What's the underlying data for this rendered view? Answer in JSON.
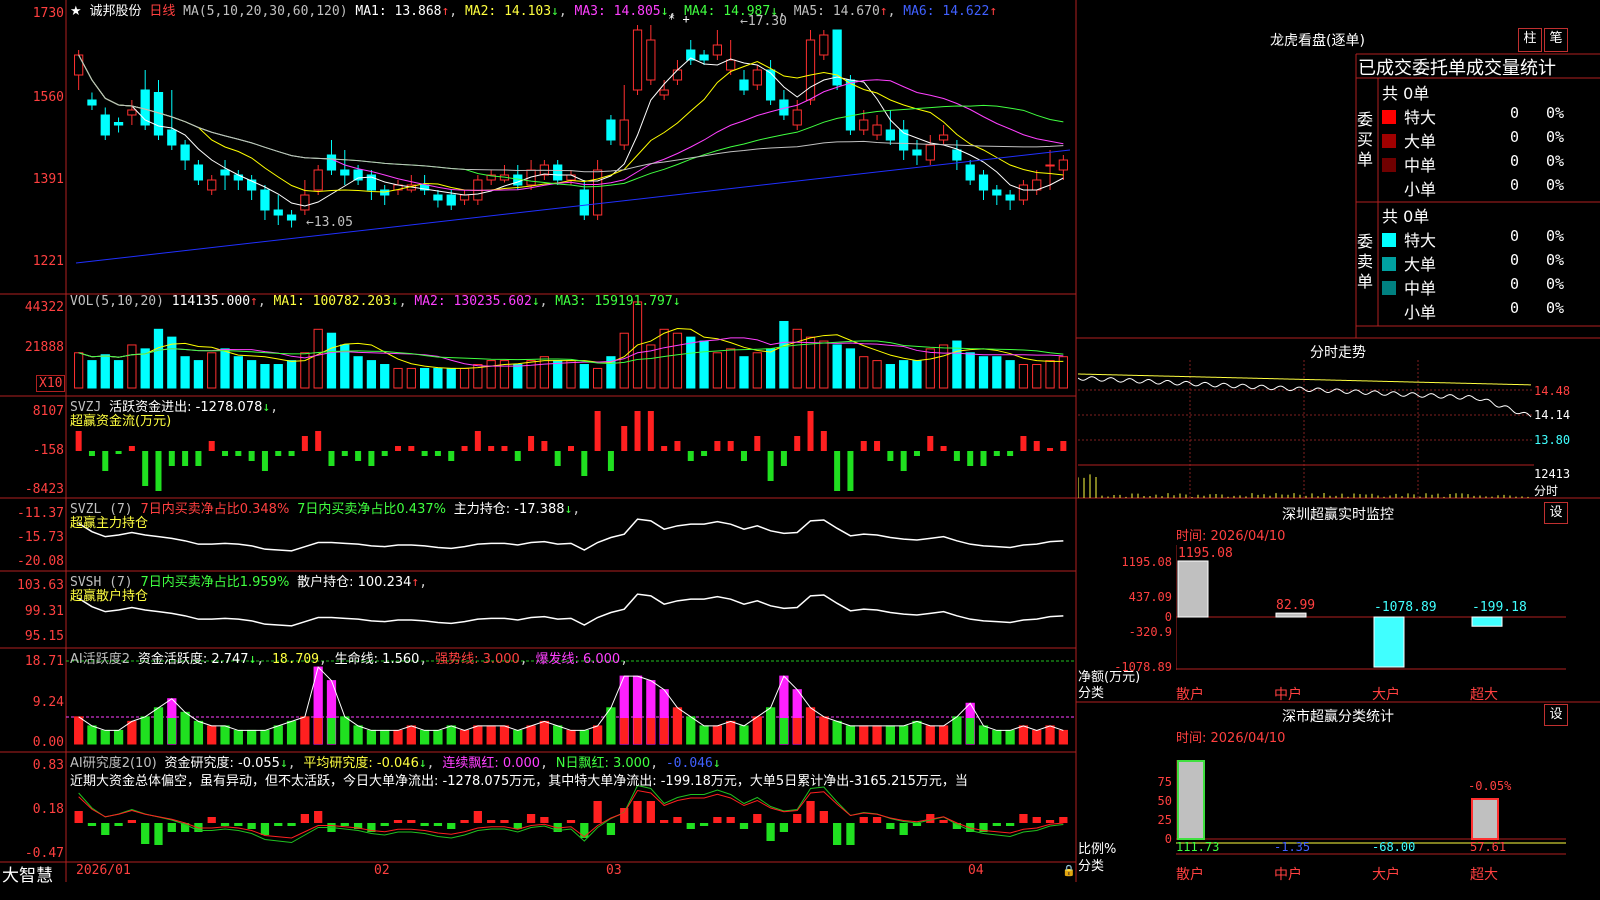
{
  "stock": {
    "name": "诚邦股份",
    "period": "日线",
    "ma_label": "MA(5,10,20,30,60,120)",
    "ma1": "MA1: 13.868",
    "ma2": "MA2: 14.103",
    "ma3": "MA3: 14.805",
    "ma4": "MA4: 14.987",
    "ma5": "MA5: 14.670",
    "ma6": "MA6: 14.622",
    "high_mark": "17.30",
    "low_mark": "13.05"
  },
  "price_axis": [
    "1730",
    "1560",
    "1391",
    "1221"
  ],
  "vol": {
    "label": "VOL(5,10,20)",
    "value": "114135.000",
    "ma1": "MA1: 100782.203",
    "ma2": "MA2: 130235.602",
    "ma3": "MA3: 159191.797",
    "axis": [
      "44322",
      "21888"
    ],
    "unit": "X10"
  },
  "svzj": {
    "label": "SVZJ",
    "desc": "活跃资金进出: -1278.078",
    "sub": "超赢资金流(万元)",
    "axis": [
      "8107",
      "-158",
      "-8423"
    ]
  },
  "svzl": {
    "label": "SVZL (7)",
    "pct1": "7日内买卖净占比0.348%",
    "pct2": "7日内买卖净占比0.437%",
    "main": "主力持仓: -17.388",
    "sub": "超赢主力持仓",
    "axis": [
      "-11.37",
      "-15.73",
      "-20.08"
    ]
  },
  "svsh": {
    "label": "SVSH (7)",
    "pct": "7日内买卖净占比1.959%",
    "retail": "散户持仓: 100.234",
    "sub": "超赢散户持仓",
    "axis": [
      "103.63",
      "99.31",
      "95.15"
    ]
  },
  "ai2": {
    "label": "AI活跃度2",
    "active": "资金活跃度: 2.747",
    "v2": "18.709",
    "life": "生命线: 1.560",
    "strong": "强势线: 3.000",
    "burst": "爆发线: 6.000",
    "axis": [
      "18.71",
      "9.24",
      "0.00"
    ]
  },
  "ai_research": {
    "label": "AI研究度2(10)",
    "r1": "资金研究度: -0.055",
    "r2": "平均研究度: -0.046",
    "r3": "连续飘红: 0.000",
    "r4": "N日飘红: 3.000",
    "r5": "-0.046",
    "summary": "近期大资金总体偏空，虽有异动，但不太活跃，今日大单净流出: -1278.075万元，其中特大单净流出: -199.18万元，大单5日累计净出-3165.215万元，当",
    "axis": [
      "0.83",
      "0.18",
      "-0.47"
    ]
  },
  "date_axis": [
    "2026/01",
    "02",
    "03",
    "04"
  ],
  "brand": "大智慧",
  "right": {
    "lhb_title": "龙虎看盘(逐单)",
    "btn_zhu": "柱",
    "btn_bi": "笔",
    "stat_title": "已成交委托单成交量统计",
    "buy": {
      "side": "委买单",
      "total": "共 0单",
      "rows": [
        {
          "name": "特大",
          "n": "0",
          "p": "0%",
          "c": "#ff0000"
        },
        {
          "name": "大单",
          "n": "0",
          "p": "0%",
          "c": "#a00000"
        },
        {
          "name": "中单",
          "n": "0",
          "p": "0%",
          "c": "#700000"
        },
        {
          "name": "小单",
          "n": "0",
          "p": "0%",
          "c": ""
        }
      ]
    },
    "sell": {
      "side": "委卖单",
      "total": "共 0单",
      "rows": [
        {
          "name": "特大",
          "n": "0",
          "p": "0%",
          "c": "#00ffff"
        },
        {
          "name": "大单",
          "n": "0",
          "p": "0%",
          "c": "#00a0a0"
        },
        {
          "name": "中单",
          "n": "0",
          "p": "0%",
          "c": "#008080"
        },
        {
          "name": "小单",
          "n": "0",
          "p": "0%",
          "c": ""
        }
      ]
    },
    "intraday_title": "分时走势",
    "intraday_axis": [
      "14.48",
      "14.14",
      "13.80",
      "12413",
      "分时"
    ],
    "sz_title": "深圳超赢实时监控",
    "sz_btn": "设",
    "sz_time": "时间: 2026/04/10",
    "sz_axis": [
      "1195.08",
      "437.09",
      "0",
      "-320.9",
      "-1078.89"
    ],
    "sz_values": [
      "1195.08",
      "82.99",
      "-1078.89",
      "-199.18"
    ],
    "sz_ylabel": "净额(万元)",
    "sz_xlabel": "分类",
    "cats": [
      "散户",
      "中户",
      "大户",
      "超大"
    ],
    "cl_title": "深市超赢分类统计",
    "cl_btn": "设",
    "cl_time": "时间: 2026/04/10",
    "cl_axis": [
      "75",
      "50",
      "25",
      "0"
    ],
    "cl_top": "-0.05%",
    "cl_values": [
      "111.73",
      "-1.35",
      "-68.00",
      "57.61"
    ],
    "cl_ylabel": "比例%",
    "cl_xlabel": "分类"
  },
  "chart_data": {
    "type": "candlestick",
    "candles": [
      [
        1610,
        1650,
        1660,
        1580
      ],
      [
        1560,
        1550,
        1575,
        1540
      ],
      [
        1530,
        1490,
        1545,
        1480
      ],
      [
        1515,
        1510,
        1525,
        1495
      ],
      [
        1530,
        1540,
        1560,
        1510
      ],
      [
        1580,
        1510,
        1620,
        1500
      ],
      [
        1575,
        1490,
        1600,
        1480
      ],
      [
        1500,
        1470,
        1580,
        1460
      ],
      [
        1470,
        1440,
        1480,
        1420
      ],
      [
        1430,
        1400,
        1440,
        1390
      ],
      [
        1380,
        1400,
        1410,
        1370
      ],
      [
        1420,
        1410,
        1440,
        1380
      ],
      [
        1410,
        1400,
        1420,
        1380
      ],
      [
        1400,
        1380,
        1410,
        1360
      ],
      [
        1380,
        1340,
        1390,
        1320
      ],
      [
        1340,
        1330,
        1370,
        1310
      ],
      [
        1330,
        1320,
        1340,
        1305
      ],
      [
        1340,
        1370,
        1400,
        1330
      ],
      [
        1380,
        1420,
        1430,
        1370
      ],
      [
        1450,
        1420,
        1480,
        1410
      ],
      [
        1420,
        1410,
        1460,
        1390
      ],
      [
        1420,
        1400,
        1430,
        1390
      ],
      [
        1410,
        1380,
        1420,
        1360
      ],
      [
        1380,
        1370,
        1390,
        1350
      ],
      [
        1380,
        1390,
        1400,
        1370
      ],
      [
        1380,
        1390,
        1410,
        1375
      ],
      [
        1390,
        1380,
        1410,
        1370
      ],
      [
        1370,
        1360,
        1380,
        1345
      ],
      [
        1370,
        1350,
        1380,
        1340
      ],
      [
        1360,
        1370,
        1380,
        1350
      ],
      [
        1360,
        1400,
        1410,
        1350
      ],
      [
        1400,
        1410,
        1420,
        1390
      ],
      [
        1400,
        1410,
        1430,
        1395
      ],
      [
        1410,
        1390,
        1430,
        1380
      ],
      [
        1390,
        1420,
        1440,
        1380
      ],
      [
        1410,
        1430,
        1440,
        1400
      ],
      [
        1430,
        1400,
        1440,
        1390
      ],
      [
        1400,
        1410,
        1420,
        1390
      ],
      [
        1380,
        1330,
        1400,
        1320
      ],
      [
        1330,
        1420,
        1440,
        1320
      ],
      [
        1520,
        1480,
        1530,
        1470
      ],
      [
        1470,
        1520,
        1590,
        1460
      ],
      [
        1580,
        1700,
        1710,
        1570
      ],
      [
        1600,
        1680,
        1710,
        1590
      ],
      [
        1570,
        1580,
        1600,
        1560
      ],
      [
        1600,
        1620,
        1640,
        1590
      ],
      [
        1660,
        1640,
        1680,
        1630
      ],
      [
        1650,
        1640,
        1660,
        1630
      ],
      [
        1650,
        1670,
        1700,
        1640
      ],
      [
        1620,
        1640,
        1680,
        1610
      ],
      [
        1600,
        1580,
        1620,
        1570
      ],
      [
        1590,
        1620,
        1630,
        1580
      ],
      [
        1620,
        1560,
        1640,
        1550
      ],
      [
        1560,
        1530,
        1580,
        1520
      ],
      [
        1510,
        1540,
        1560,
        1500
      ],
      [
        1560,
        1680,
        1700,
        1550
      ],
      [
        1650,
        1690,
        1700,
        1640
      ],
      [
        1700,
        1590,
        1700,
        1580
      ],
      [
        1600,
        1500,
        1610,
        1490
      ],
      [
        1500,
        1520,
        1540,
        1490
      ],
      [
        1490,
        1510,
        1530,
        1480
      ],
      [
        1500,
        1480,
        1540,
        1470
      ],
      [
        1500,
        1460,
        1520,
        1440
      ],
      [
        1460,
        1450,
        1480,
        1430
      ],
      [
        1440,
        1470,
        1490,
        1430
      ],
      [
        1480,
        1490,
        1510,
        1470
      ],
      [
        1460,
        1440,
        1480,
        1420
      ],
      [
        1430,
        1400,
        1440,
        1390
      ],
      [
        1410,
        1380,
        1420,
        1360
      ],
      [
        1380,
        1370,
        1390,
        1350
      ],
      [
        1370,
        1360,
        1380,
        1340
      ],
      [
        1360,
        1390,
        1400,
        1350
      ],
      [
        1380,
        1400,
        1420,
        1370
      ],
      [
        1430,
        1430,
        1460,
        1380
      ],
      [
        1420,
        1440,
        1450,
        1400
      ]
    ],
    "vol_values": [
      18,
      14,
      17,
      14,
      22,
      20,
      30,
      26,
      16,
      14,
      18,
      20,
      16,
      14,
      12,
      12,
      14,
      18,
      30,
      28,
      22,
      16,
      14,
      12,
      10,
      10,
      10,
      10,
      10,
      10,
      12,
      14,
      14,
      12,
      14,
      16,
      14,
      14,
      12,
      10,
      16,
      28,
      44,
      22,
      30,
      28,
      26,
      24,
      18,
      20,
      16,
      18,
      20,
      34,
      30,
      26,
      24,
      22,
      20,
      16,
      14,
      12,
      14,
      14,
      20,
      22,
      24,
      18,
      16,
      16,
      14,
      12,
      12,
      14,
      16
    ],
    "ai_active": [
      6,
      4,
      3,
      3,
      5,
      6,
      8,
      10,
      7,
      5,
      4,
      4,
      3,
      3,
      3,
      4,
      5,
      6,
      17,
      14,
      6,
      4,
      3,
      3,
      3,
      4,
      3,
      3,
      4,
      3,
      4,
      4,
      4,
      3,
      4,
      5,
      4,
      3,
      3,
      4,
      8,
      15,
      15,
      14,
      12,
      8,
      6,
      4,
      4,
      5,
      4,
      6,
      8,
      15,
      12,
      8,
      6,
      5,
      4,
      4,
      4,
      4,
      4,
      5,
      4,
      4,
      6,
      9,
      4,
      3,
      3,
      4,
      3,
      4,
      3
    ],
    "ylim": [
      1150,
      1750
    ]
  }
}
